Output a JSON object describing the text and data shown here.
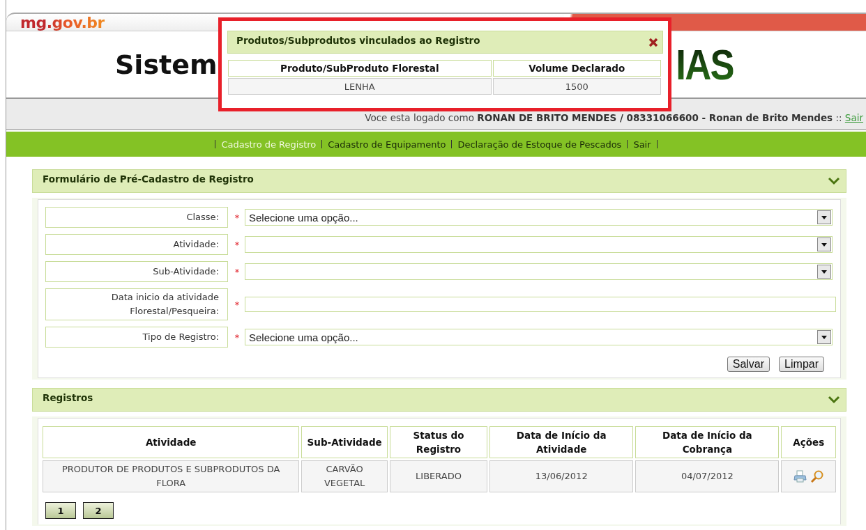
{
  "header": {
    "logo": "mg.gov.br",
    "title_left": "Sistem",
    "title_right": "IAS"
  },
  "user_bar": {
    "prefix": "Voce esta logado como ",
    "user": "RONAN DE BRITO MENDES / 08331066600 - Ronan de Brito Mendes",
    "separator": " :: ",
    "logout": "Sair"
  },
  "nav": [
    {
      "label": "Cadastro de Registro",
      "selected": true
    },
    {
      "label": "Cadastro de Equipamento",
      "selected": false
    },
    {
      "label": "Declaração de Estoque de Pescados",
      "selected": false
    },
    {
      "label": "Sair",
      "selected": false
    }
  ],
  "form_panel": {
    "title": "Formulário de Pré-Cadastro de Registro",
    "expanded": true,
    "fields": [
      {
        "label": "Classe:",
        "marker": "*",
        "kind": "select",
        "value": "Selecione uma opção..."
      },
      {
        "label": "Atividade:",
        "marker": "*",
        "kind": "select"
      },
      {
        "label": "Sub-Atividade:",
        "marker": "*",
        "kind": "select"
      },
      {
        "label": "Data inicio da atividade Florestal/Pesqueira:",
        "marker": "*",
        "kind": "text"
      },
      {
        "label": "Tipo de Registro:",
        "marker": "*",
        "kind": "select",
        "value": "Selecione uma opção..."
      }
    ],
    "buttons": [
      "Salvar",
      "Limpar"
    ]
  },
  "registros_panel": {
    "title": "Registros",
    "expanded": true,
    "table": {
      "columns": [
        "Atividade",
        "Sub-Atividade",
        "Status do Registro",
        "Data de Início da Atividade",
        "Data de Início da Cobrança",
        "Ações"
      ],
      "rows": [
        {
          "cells": [
            "PRODUTOR DE PRODUTOS E SUBPRODUTOS DA FLORA",
            "CARVÃO VEGETAL",
            "LIBERADO",
            "13/06/2012",
            "04/07/2012"
          ]
        }
      ]
    },
    "pages": [
      "1",
      "2"
    ]
  },
  "popup": {
    "title": "Produtos/Subprodutos vinculados ao Registro",
    "columns": [
      "Produto/SubProduto Florestal",
      "Volume Declarado"
    ],
    "rows": [
      [
        "LENHA",
        "1500"
      ]
    ]
  }
}
